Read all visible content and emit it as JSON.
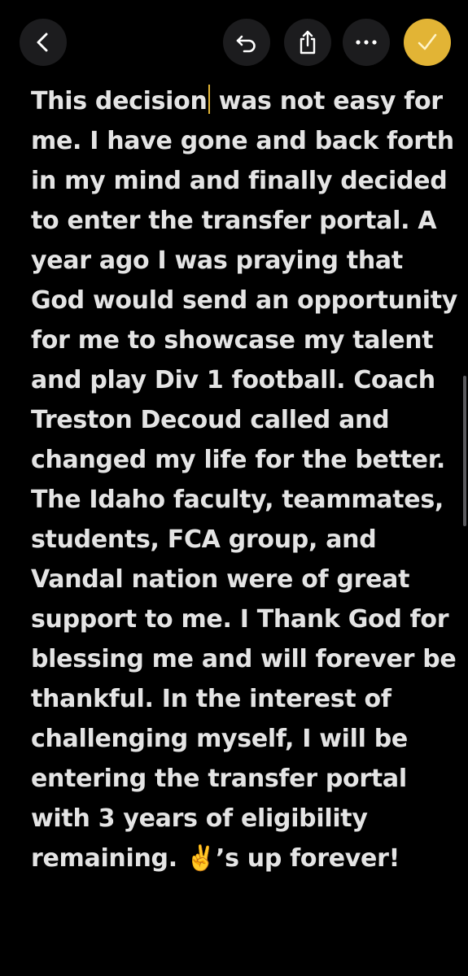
{
  "toolbar": {
    "back_icon": "chevron-left-icon",
    "undo_icon": "undo-icon",
    "share_icon": "share-icon",
    "more_icon": "ellipsis-icon",
    "done_icon": "checkmark-icon",
    "accent_color": "#e2b435",
    "button_color": "#1c1c1e"
  },
  "note": {
    "text_before_cursor": "This decision",
    "text_after_cursor": " was not easy for me. I have gone and back forth in my mind and finally decided to enter the transfer portal. A year ago I was praying that God would send an opportunity for me to showcase my talent and play Div 1 football. Coach Treston Decoud called and changed my life for the better. The Idaho faculty, teammates, students, FCA group, and Vandal nation were of great support to me. I Thank God for blessing me and will forever be thankful. In the interest of challenging myself, I will be entering the transfer portal with 3 years of eligibility remaining. ✌️’s up forever!",
    "text_color": "#e4e4e4"
  }
}
